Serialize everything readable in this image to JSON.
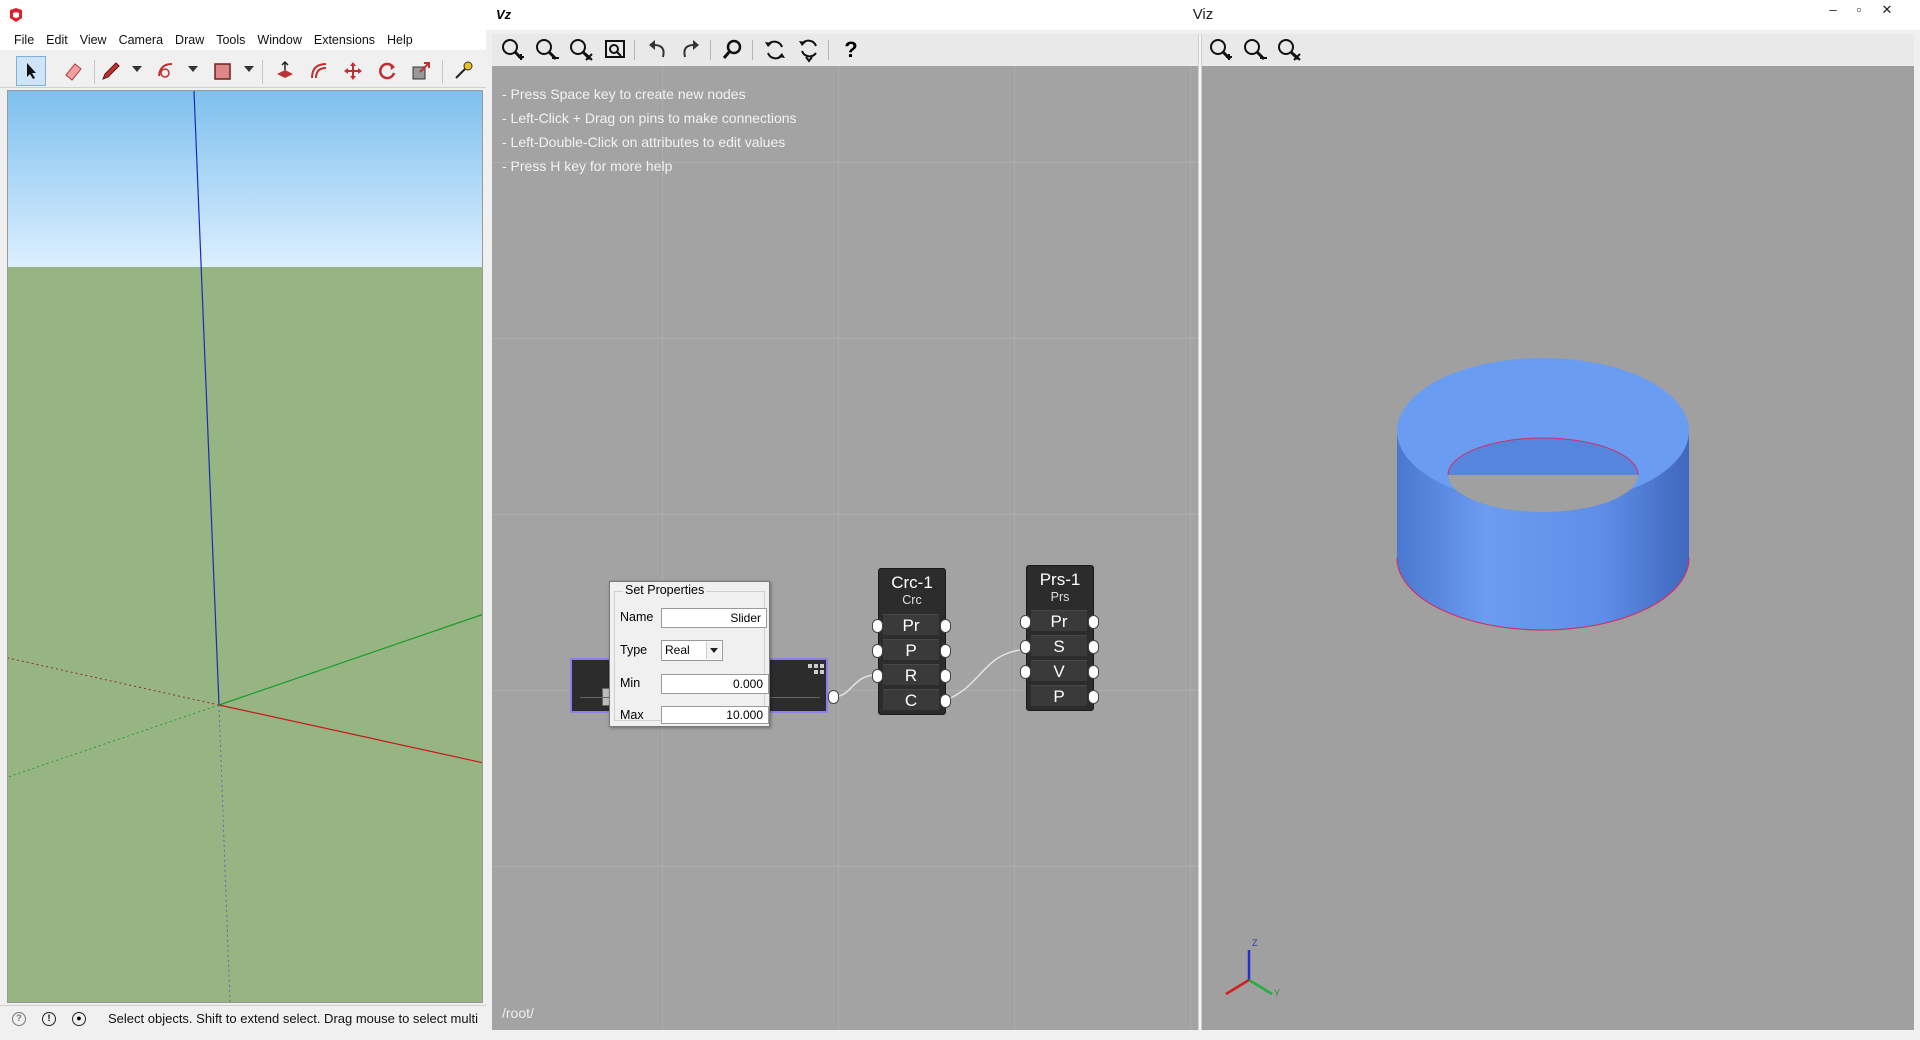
{
  "left_app": {
    "menu": [
      "File",
      "Edit",
      "View",
      "Camera",
      "Draw",
      "Tools",
      "Window",
      "Extensions",
      "Help"
    ],
    "toolbar_icons": [
      "select-icon",
      "eraser-icon",
      "pencil-icon",
      "arc-icon",
      "rectangle-icon",
      "push-pull-icon",
      "offset-icon",
      "move-icon",
      "rotate-icon",
      "scale-icon",
      "tape-measure-icon"
    ],
    "status_text": "Select objects. Shift to extend select. Drag mouse to select multi"
  },
  "viz": {
    "logo": "Vz",
    "title": "Viz",
    "window_controls": [
      "–",
      "▫",
      "✕"
    ],
    "help_lines": [
      "- Press Space key to create new nodes",
      "- Left-Click + Drag on pins to make connections",
      "- Left-Double-Click on attributes to edit values",
      "- Press H key for more help"
    ],
    "breadcrumb": "/root/",
    "help_button": "?",
    "nodes": {
      "circle": {
        "title": "Crc-1",
        "type": "Crc",
        "pins": [
          "Pr",
          "P",
          "R",
          "C"
        ]
      },
      "prism": {
        "title": "Prs-1",
        "type": "Prs",
        "pins": [
          "Pr",
          "S",
          "V",
          "P"
        ]
      }
    },
    "set_properties": {
      "legend": "Set Properties",
      "name_label": "Name",
      "name_value": "Slider",
      "type_label": "Type",
      "type_value": "Real",
      "min_label": "Min",
      "min_value": "0.000",
      "max_label": "Max",
      "max_value": "10.000"
    },
    "axis_labels": {
      "z": "Z",
      "y": "Y"
    },
    "colors": {
      "cylinder": "#5b8fe8",
      "canvas": "#a3a3a3",
      "node": "#2c2c2c",
      "selection": "#8a7fe6"
    }
  }
}
